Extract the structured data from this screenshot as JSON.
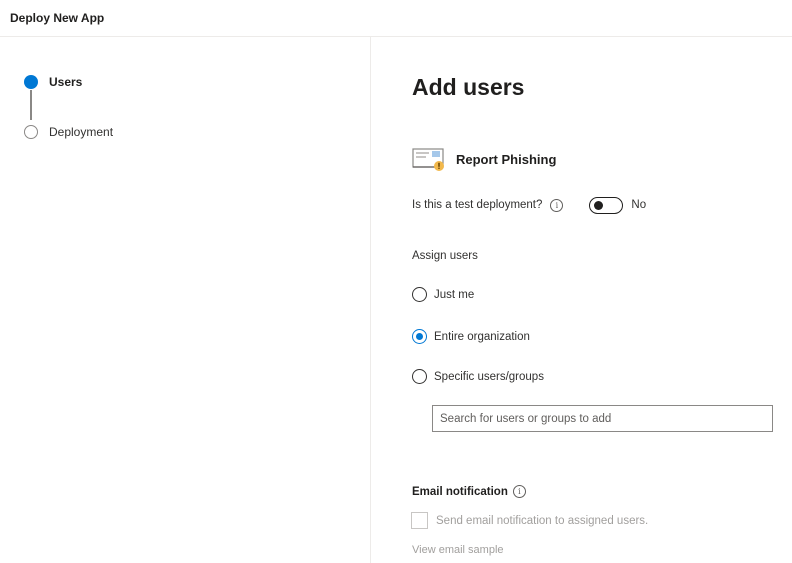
{
  "header": {
    "title": "Deploy New App"
  },
  "stepper": {
    "steps": [
      {
        "label": "Users",
        "state": "active"
      },
      {
        "label": "Deployment",
        "state": "inactive"
      }
    ]
  },
  "main": {
    "title": "Add users",
    "app": {
      "name": "Report Phishing",
      "icon": "email-warning-icon"
    },
    "test_deployment": {
      "label": "Is this a test deployment?",
      "info_icon": "i",
      "toggle_on": false,
      "toggle_text": "No"
    },
    "assign": {
      "label": "Assign users",
      "options": [
        {
          "label": "Just me",
          "checked": false
        },
        {
          "label": "Entire organization",
          "checked": true
        },
        {
          "label": "Specific users/groups",
          "checked": false
        }
      ],
      "search_placeholder": "Search for users or groups to add"
    },
    "email": {
      "heading": "Email notification",
      "info_icon": "i",
      "checkbox_label": "Send email notification to assigned users.",
      "checkbox_checked": false,
      "view_sample": "View email sample"
    }
  },
  "colors": {
    "accent": "#0078d4",
    "disabled_text": "#a19f9d",
    "border": "#8a8886"
  }
}
